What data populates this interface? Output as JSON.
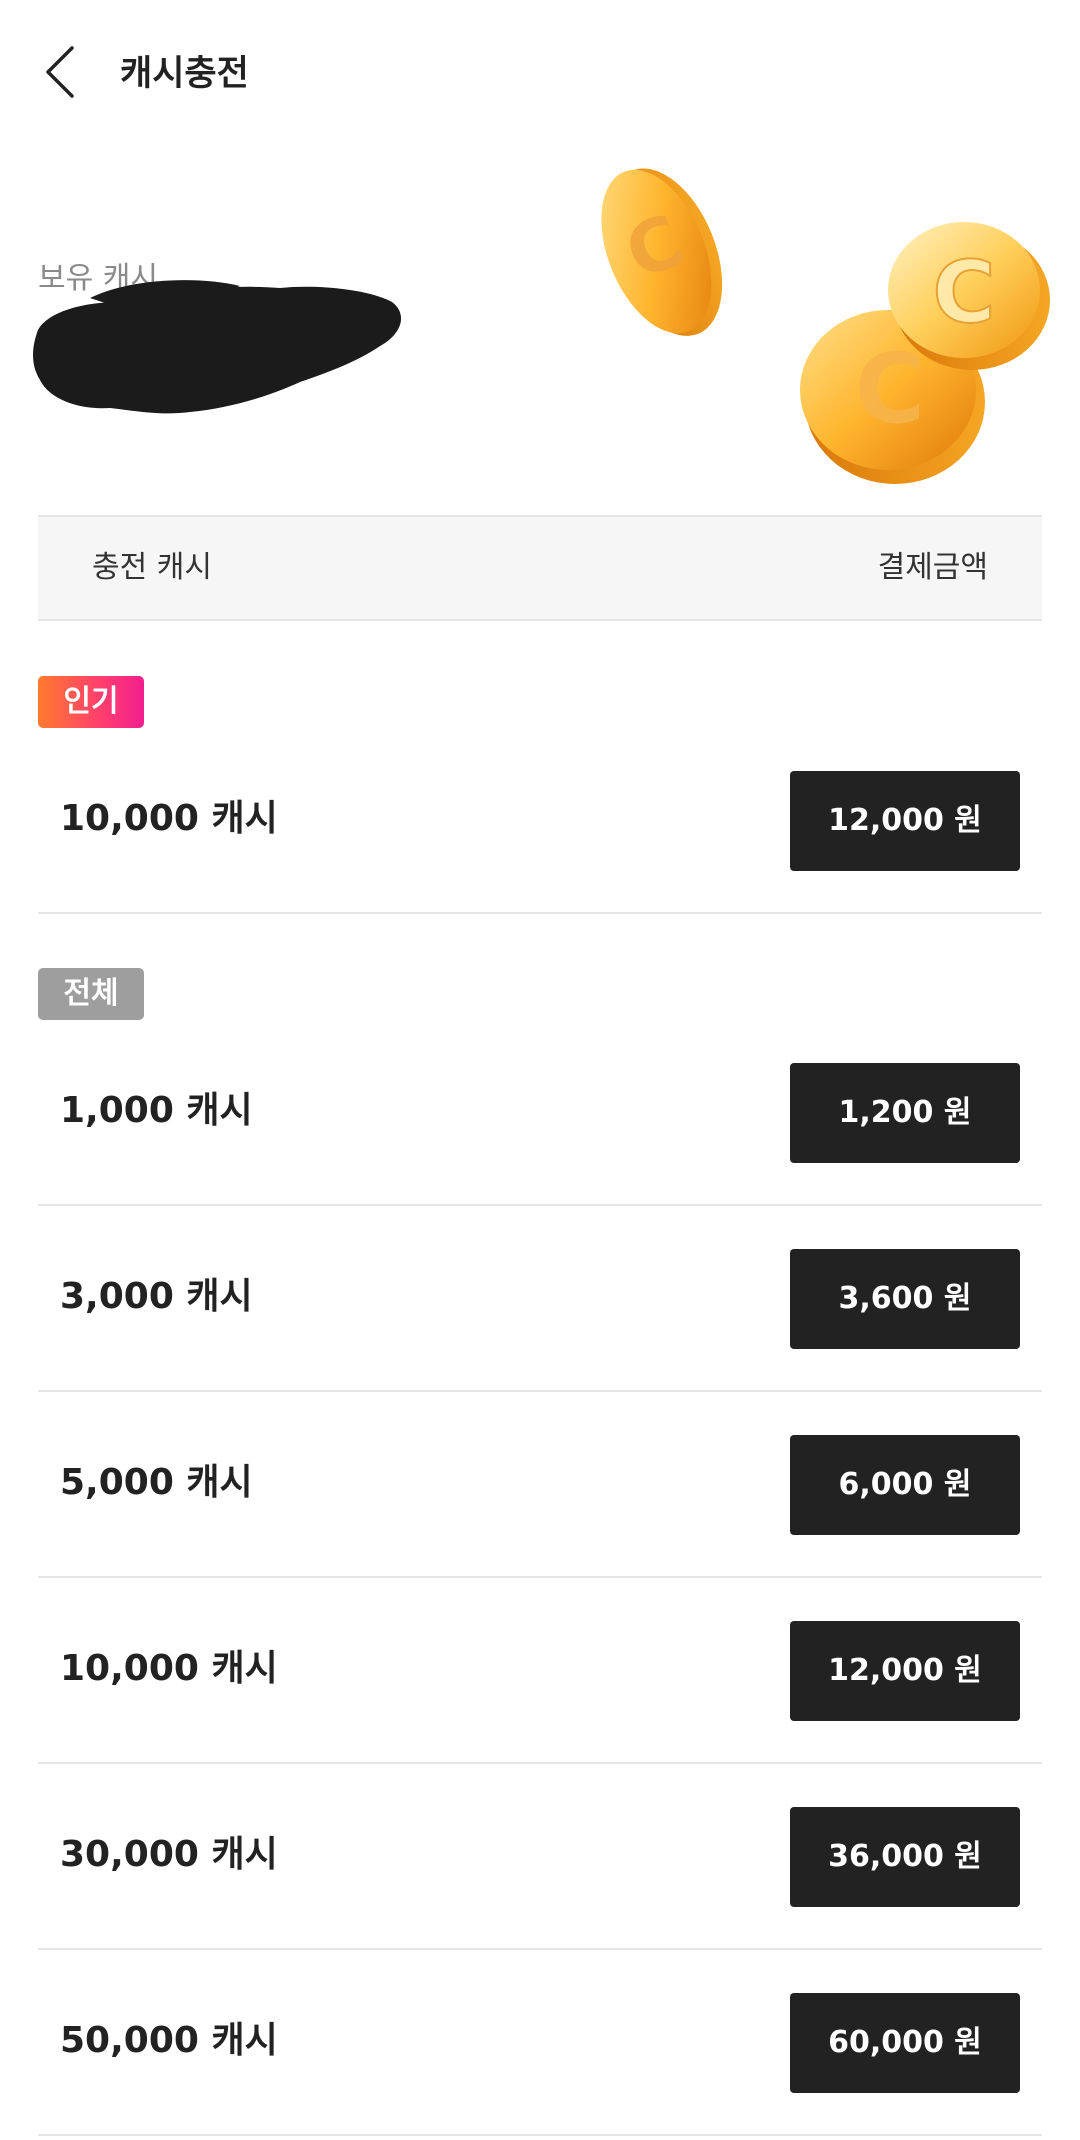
{
  "header": {
    "title": "캐시충전"
  },
  "balance": {
    "label": "보유 캐시"
  },
  "table_header": {
    "left": "충전 캐시",
    "right": "결제금액"
  },
  "sections": {
    "popular": {
      "badge": "인기",
      "items": [
        {
          "cash": "10,000 캐시",
          "price": "12,000 원"
        }
      ]
    },
    "all": {
      "badge": "전체",
      "items": [
        {
          "cash": "1,000 캐시",
          "price": "1,200 원"
        },
        {
          "cash": "3,000 캐시",
          "price": "3,600 원"
        },
        {
          "cash": "5,000 캐시",
          "price": "6,000 원"
        },
        {
          "cash": "10,000 캐시",
          "price": "12,000 원"
        },
        {
          "cash": "30,000 캐시",
          "price": "36,000 원"
        },
        {
          "cash": "50,000 캐시",
          "price": "60,000 원"
        }
      ]
    }
  },
  "colors": {
    "button_bg": "#222222",
    "badge_popular_start": "#ff7a2e",
    "badge_popular_end": "#f21f8e",
    "badge_all": "#9e9e9e"
  }
}
